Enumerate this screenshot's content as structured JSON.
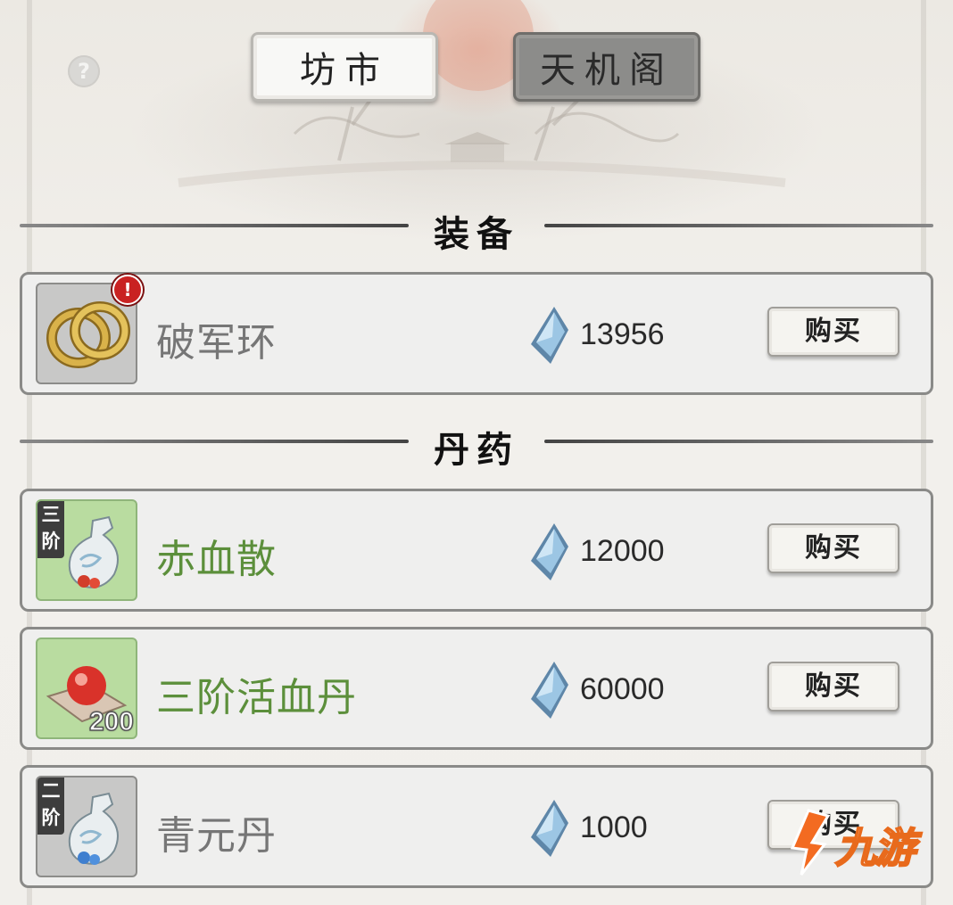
{
  "header": {
    "help_icon": "question-mark-icon",
    "help_glyph": "?",
    "tabs": [
      {
        "label": "坊市",
        "active": true
      },
      {
        "label": "天机阁",
        "active": false
      }
    ]
  },
  "sections": [
    {
      "title": "装备",
      "items": [
        {
          "name": "破军环",
          "name_color": "#767676",
          "icon": "gold-rings-icon",
          "alert": "!",
          "price": "13956",
          "currency_icon": "spirit-crystal-icon",
          "buy_label": "购买"
        }
      ]
    },
    {
      "title": "丹药",
      "items": [
        {
          "name": "赤血散",
          "name_color": "#5c8f3b",
          "icon": "medicine-vase-icon",
          "tier_badge": "三阶",
          "price": "12000",
          "currency_icon": "spirit-crystal-icon",
          "buy_label": "购买"
        },
        {
          "name": "三阶活血丹",
          "name_color": "#5c8f3b",
          "icon": "red-pill-icon",
          "quantity": "200",
          "price": "60000",
          "currency_icon": "spirit-crystal-icon",
          "buy_label": "购买"
        },
        {
          "name": "青元丹",
          "name_color": "#767676",
          "icon": "medicine-vase-icon",
          "tier_badge": "二阶",
          "price": "1000",
          "currency_icon": "spirit-crystal-icon",
          "buy_label": "购买"
        }
      ]
    }
  ],
  "watermark": {
    "text": "九游",
    "icon": "jiuyou-logo-icon"
  },
  "colors": {
    "accent_green": "#5c8f3b",
    "thumb_green": "#b9dca0",
    "thumb_gray": "#c8c8c7",
    "alert_red": "#c92222"
  }
}
